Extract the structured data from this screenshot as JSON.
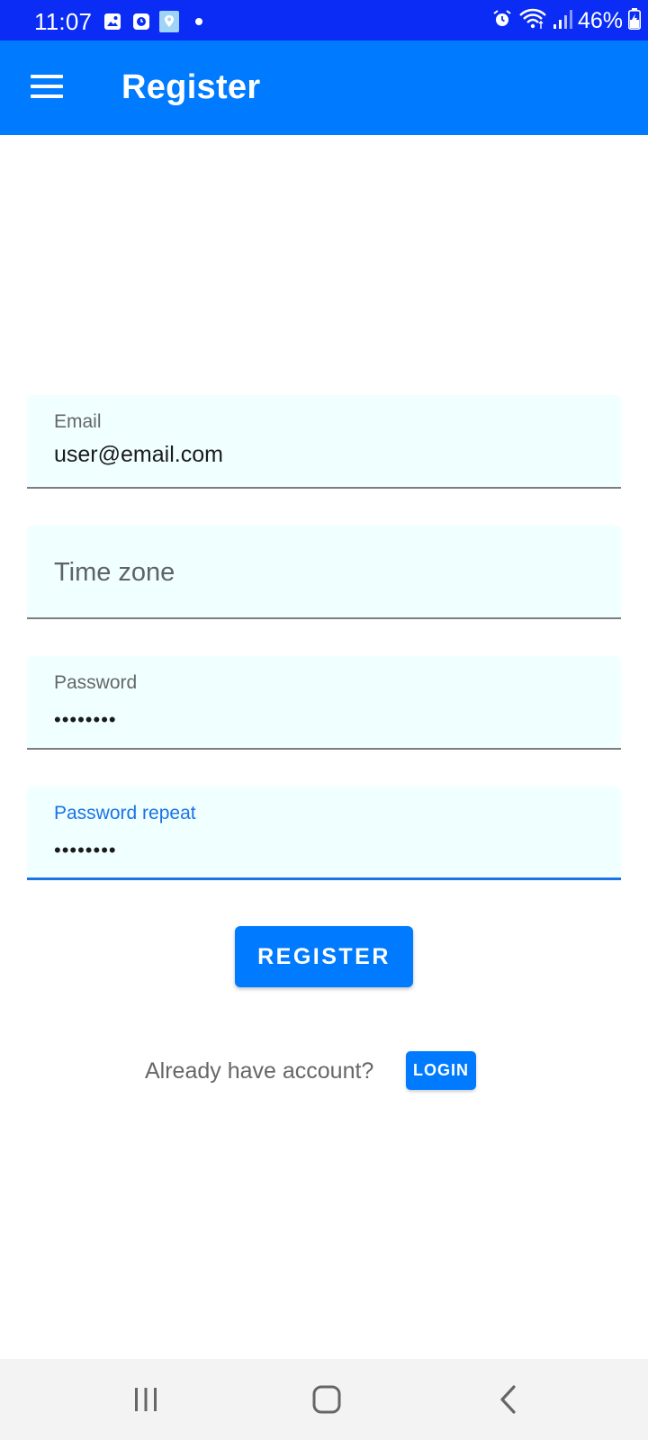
{
  "status_bar": {
    "time": "11:07",
    "battery": "46%",
    "notification_icons": [
      "image-icon",
      "clock-app-icon",
      "location-app-icon",
      "dot-icon"
    ],
    "system_icons": [
      "alarm-icon",
      "wifi-icon",
      "signal-icon",
      "battery-icon"
    ]
  },
  "app_bar": {
    "title": "Register",
    "color": "#007bff"
  },
  "form": {
    "email": {
      "label": "Email",
      "value": "user@email.com"
    },
    "timezone": {
      "placeholder": "Time zone"
    },
    "password": {
      "label": "Password",
      "value": "••••••••"
    },
    "password_repeat": {
      "label": "Password repeat",
      "value": "••••••••"
    }
  },
  "register_button": {
    "label": "REGISTER"
  },
  "login_section": {
    "prompt": "Already have account?",
    "button_label": "LOGIN"
  },
  "nav_bar": {
    "buttons": [
      "recent-apps-icon",
      "home-icon",
      "back-icon"
    ]
  },
  "colors": {
    "status_bar": "#0a2cf5",
    "primary": "#007bff",
    "field_background": "#f0ffff",
    "focus": "#1a73e8"
  }
}
